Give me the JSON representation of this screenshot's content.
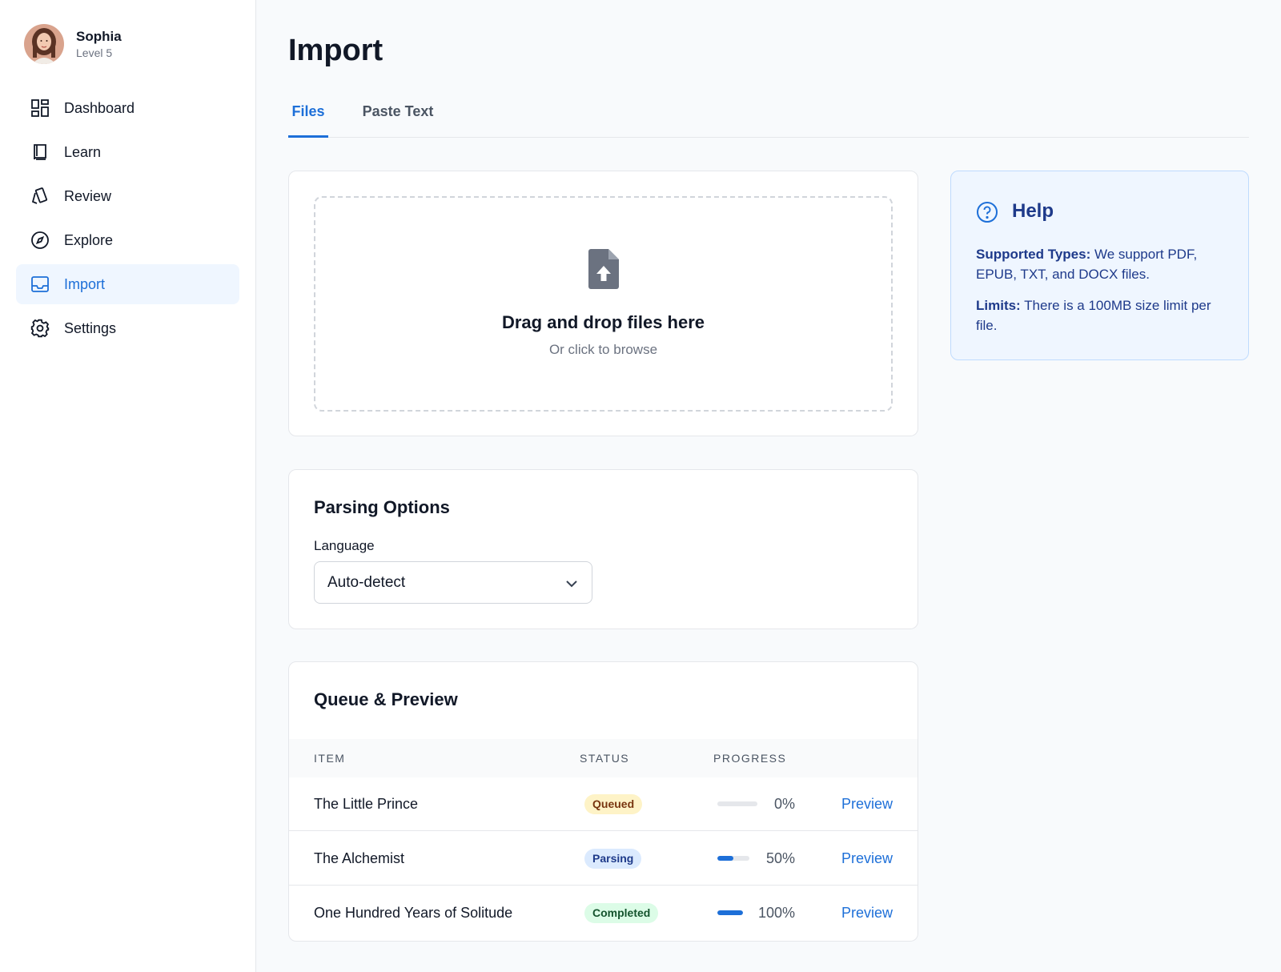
{
  "user": {
    "name": "Sophia",
    "level": "Level 5"
  },
  "nav": {
    "items": [
      {
        "label": "Dashboard",
        "icon": "dashboard-icon"
      },
      {
        "label": "Learn",
        "icon": "book-icon"
      },
      {
        "label": "Review",
        "icon": "cards-icon"
      },
      {
        "label": "Explore",
        "icon": "compass-icon"
      },
      {
        "label": "Import",
        "icon": "inbox-icon",
        "active": true
      },
      {
        "label": "Settings",
        "icon": "gear-icon"
      }
    ]
  },
  "page": {
    "title": "Import"
  },
  "tabs": [
    {
      "label": "Files",
      "active": true
    },
    {
      "label": "Paste Text",
      "active": false
    }
  ],
  "dropzone": {
    "title": "Drag and drop files here",
    "subtitle": "Or click to browse",
    "icon": "file-upload-icon"
  },
  "parsing": {
    "title": "Parsing Options",
    "language_label": "Language",
    "language_value": "Auto-detect"
  },
  "queue": {
    "title": "Queue & Preview",
    "columns": [
      "ITEM",
      "STATUS",
      "PROGRESS"
    ],
    "rows": [
      {
        "name": "The Little Prince",
        "status": "Queued",
        "progress": 0,
        "progress_label": "0%",
        "action": "Preview"
      },
      {
        "name": "The Alchemist",
        "status": "Parsing",
        "progress": 50,
        "progress_label": "50%",
        "action": "Preview"
      },
      {
        "name": "One Hundred Years of Solitude",
        "status": "Completed",
        "progress": 100,
        "progress_label": "100%",
        "action": "Preview"
      }
    ]
  },
  "help": {
    "title": "Help",
    "types_label": "Supported Types:",
    "types_text": "We support PDF, EPUB, TXT, and DOCX files.",
    "limits_label": "Limits:",
    "limits_text": "There is a 100MB size limit per file."
  },
  "colors": {
    "accent": "#1d6fd8",
    "help_bg": "#eff6ff",
    "help_text": "#1e3a8a"
  }
}
